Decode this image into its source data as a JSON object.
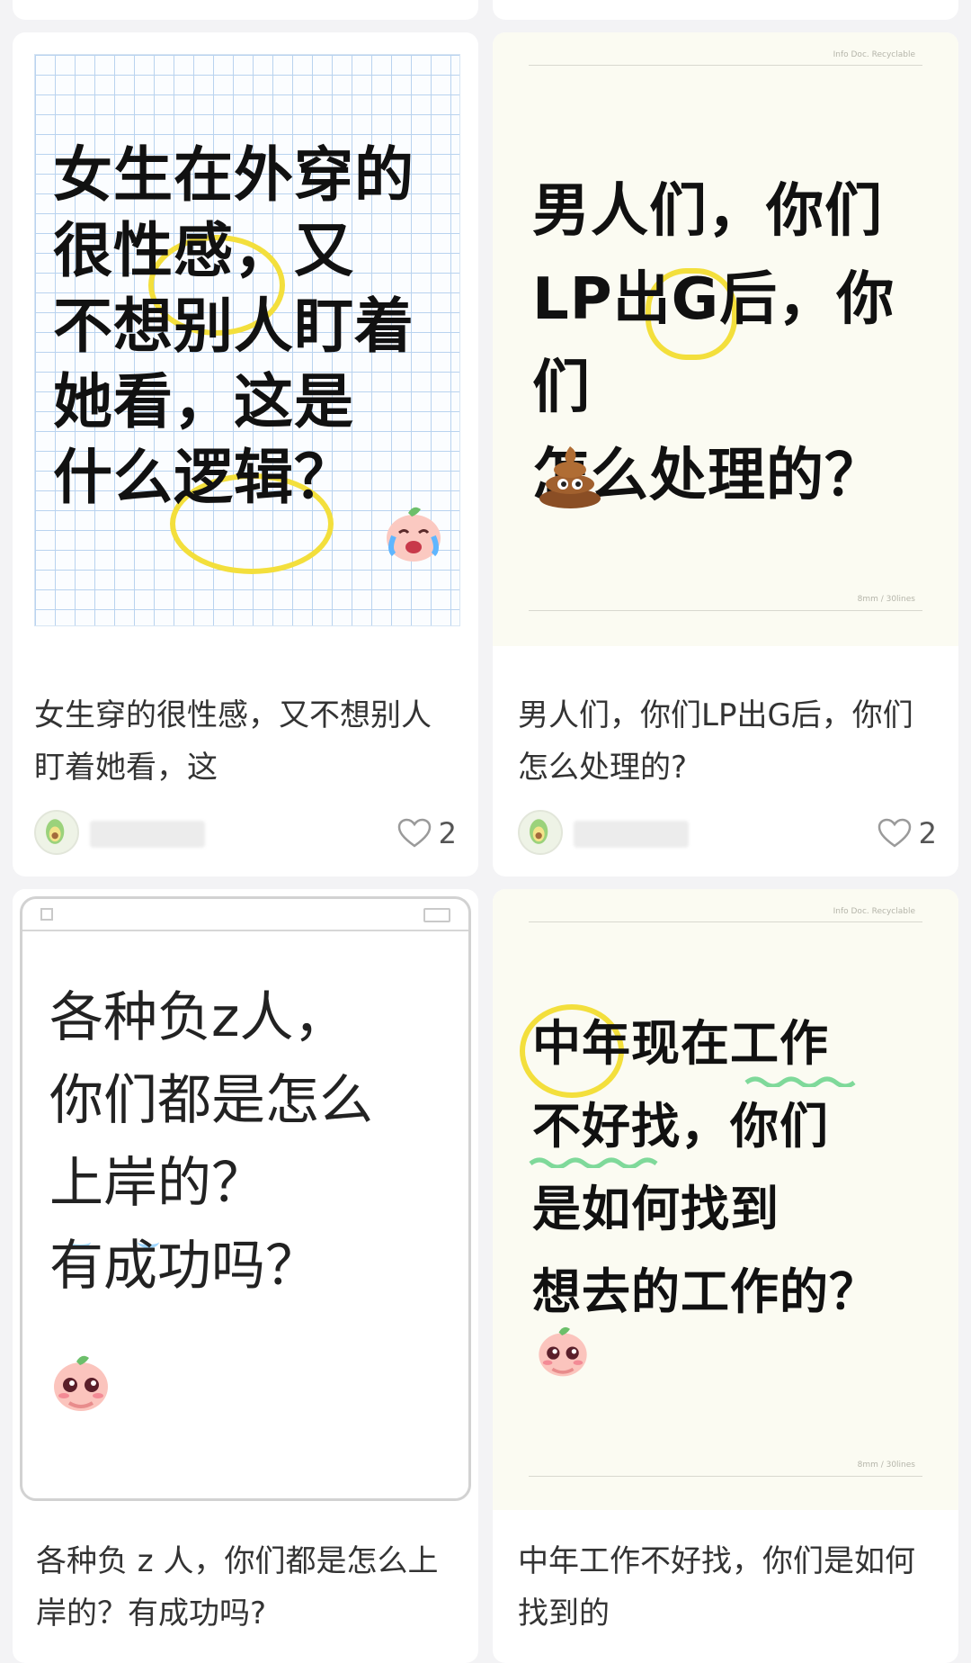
{
  "cards": [
    {
      "cover_text": "女生在外穿的\n很性感，又\n不想别人盯着\n她看，这是\n什么逻辑？",
      "caption": "女生穿的很性感，又不想别人盯着她看，这",
      "likes": "2",
      "cover_icon": "crying-peach-emoji"
    },
    {
      "cover_meta_top": "Info Doc.  Recyclable",
      "cover_text": "男人们，你们\nLP出G后，你们\n怎么处理的？",
      "cover_meta_bottom": "8mm / 30lines",
      "caption": "男人们，你们LP出G后，你们怎么处理的?",
      "likes": "2",
      "cover_icon": "poop-emoji"
    },
    {
      "cover_text": "各种负z人，\n你们都是怎么\n上岸的？\n有成功吗？",
      "caption": "各种负 z 人，你们都是怎么上岸的？有成功吗?",
      "cover_icon": "shy-peach-emoji"
    },
    {
      "cover_meta_top": "Info Doc.  Recyclable",
      "cover_text": "中年现在工作\n不好找，你们\n是如何找到\n想去的工作的？",
      "cover_meta_bottom": "8mm / 30lines",
      "caption": "中年工作不好找，你们是如何找到的",
      "cover_icon": "shy-peach-emoji"
    }
  ],
  "colors": {
    "highlight_yellow": "#f3df3c",
    "highlight_green": "#7fd99a",
    "like_gray": "#9a9a9a"
  }
}
